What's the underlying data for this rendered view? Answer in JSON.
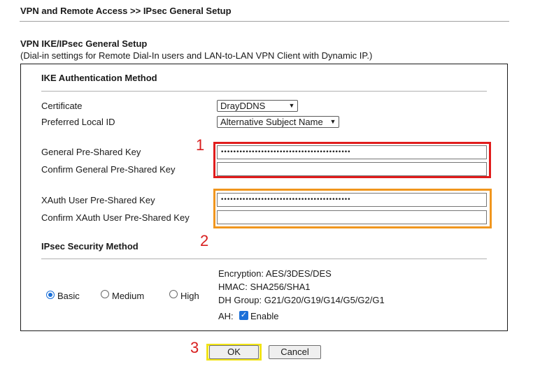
{
  "page": {
    "breadcrumb": "VPN and Remote Access >> IPsec General Setup",
    "section_title": "VPN IKE/IPsec General Setup",
    "section_subtitle": "(Dial-in settings for Remote Dial-In users and LAN-to-LAN VPN Client with Dynamic IP.)"
  },
  "ike": {
    "heading": "IKE Authentication Method",
    "certificate": {
      "label": "Certificate",
      "value": "DrayDDNS"
    },
    "preferred_local_id": {
      "label": "Preferred Local ID",
      "value": "Alternative Subject Name"
    },
    "general_psk": {
      "label": "General Pre-Shared Key",
      "value": "••••••••••••••••••••••••••••••••••••••••••"
    },
    "confirm_general_psk": {
      "label": "Confirm General Pre-Shared Key",
      "value": ""
    },
    "xauth_psk": {
      "label": "XAuth User Pre-Shared Key",
      "value": "••••••••••••••••••••••••••••••••••••••••••"
    },
    "confirm_xauth_psk": {
      "label": "Confirm XAuth User Pre-Shared Key",
      "value": ""
    }
  },
  "ipsec": {
    "heading": "IPsec Security Method",
    "options": [
      {
        "label": "Basic",
        "selected": true
      },
      {
        "label": "Medium",
        "selected": false
      },
      {
        "label": "High",
        "selected": false
      }
    ],
    "encryption": "Encryption: AES/3DES/DES",
    "hmac": "HMAC: SHA256/SHA1",
    "dh_group": "DH Group: G21/G20/G19/G14/G5/G2/G1",
    "ah_label": "AH:",
    "ah_enable_label": "Enable",
    "ah_enabled": true
  },
  "buttons": {
    "ok": "OK",
    "cancel": "Cancel"
  },
  "annotations": {
    "marker_1": "1",
    "marker_2": "2",
    "marker_3": "3"
  },
  "colors": {
    "marker_text": "#d81e1e",
    "box_red": "#e01c1c",
    "box_orange": "#f0961e",
    "box_yellow": "#f2e416",
    "accent": "#1a6fd8"
  }
}
